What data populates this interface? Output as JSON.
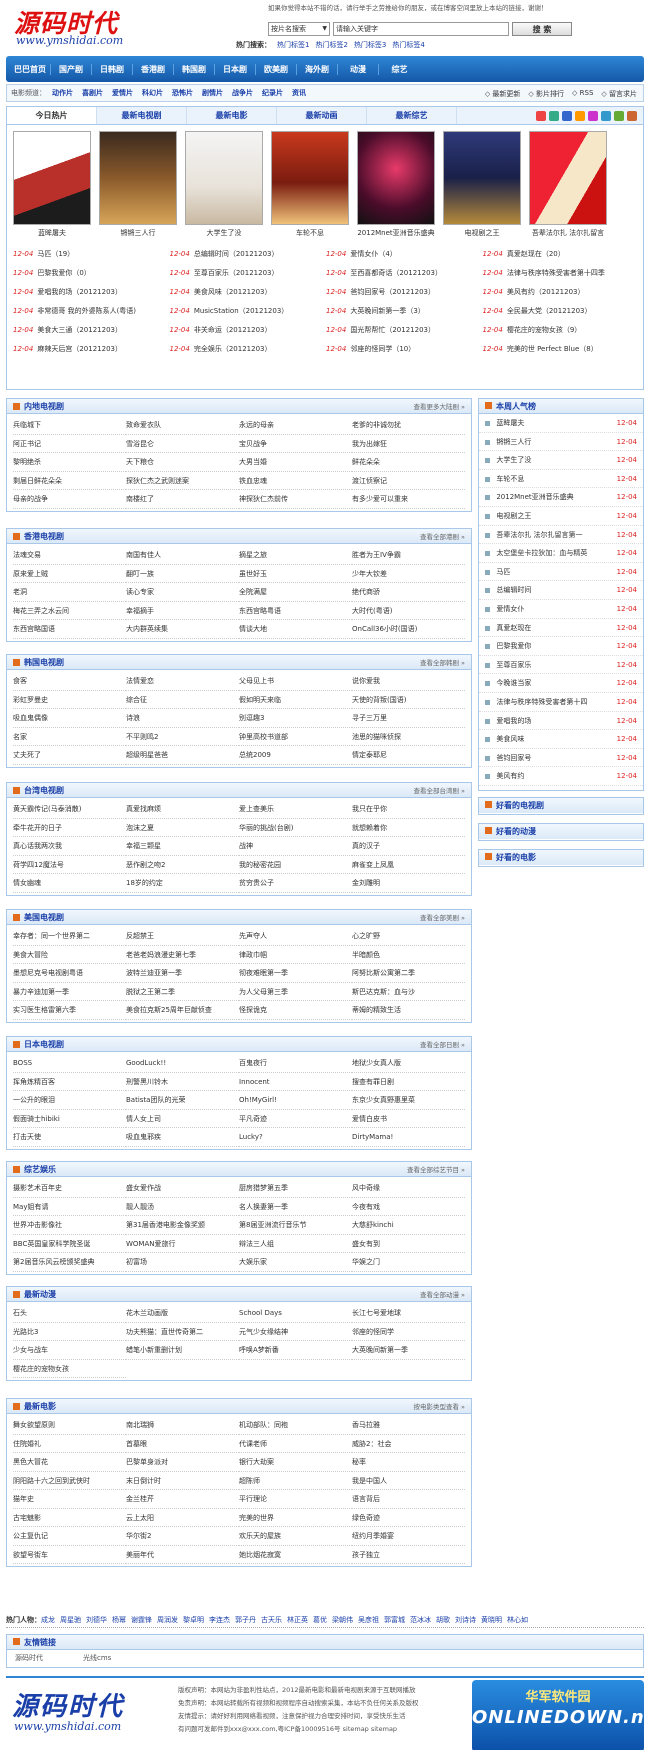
{
  "header": {
    "logo_cn": "源码时代",
    "logo_url": "www.ymshidai.com",
    "notice": "如果你觉得本站不错的话，请行举手之劳推给你的朋友，或在博客空间里放上本站的链接，谢谢！",
    "search_select": "按片名搜索",
    "search_value": "请输入关键字",
    "search_button": "搜 索",
    "hot_label": "热门搜索：",
    "hot_words": [
      "热门标签1",
      "热门标签2",
      "热门标签3",
      "热门标签4"
    ]
  },
  "nav": [
    "巴巴首页",
    "国产剧",
    "日韩剧",
    "香港剧",
    "韩国剧",
    "日本剧",
    "欧美剧",
    "海外剧",
    "动漫",
    "综艺"
  ],
  "subnav": {
    "label": "电影频道：",
    "items": [
      "动作片",
      "喜剧片",
      "爱情片",
      "科幻片",
      "恐怖片",
      "剧情片",
      "战争片",
      "纪录片",
      "资讯"
    ],
    "right": [
      "◇ 最新更新",
      "◇ 影片排行",
      "◇ RSS",
      "◇ 留言求片"
    ]
  },
  "featured": {
    "tabs": [
      "今日热片",
      "最新电视剧",
      "最新电影",
      "最新动画",
      "最新综艺"
    ],
    "posters": [
      "蓝眸屠夫",
      "锵锵三人行",
      "大学生了没",
      "车轮不息",
      "2012Mnet亚洲音乐盛典",
      "电视剧之王",
      "吾辈法尔扎 法尔扎留言"
    ],
    "newlist": [
      {
        "d": "12-04",
        "t": "马匹（19）"
      },
      {
        "d": "12-04",
        "t": "总编辑时间（20121203）"
      },
      {
        "d": "12-04",
        "t": "爱情女仆（4）"
      },
      {
        "d": "12-04",
        "t": "真爱赵现在（20）"
      },
      {
        "d": "12-04",
        "t": "巴黎我爱你（0）"
      },
      {
        "d": "12-04",
        "t": "至尊百家乐（20121203）"
      },
      {
        "d": "12-04",
        "t": "至西喜都奇话（20121203）"
      },
      {
        "d": "12-04",
        "t": "法律与秩序特殊受害者第十四季"
      },
      {
        "d": "12-04",
        "t": "爱唱我的场（20121203）"
      },
      {
        "d": "12-04",
        "t": "美食风味（20121203）"
      },
      {
        "d": "12-04",
        "t": "爸钧回家号（20121203）"
      },
      {
        "d": "12-04",
        "t": "美风有约（20121203）"
      },
      {
        "d": "12-04",
        "t": "非常德哥 我的外婆陈系人(粤语)"
      },
      {
        "d": "12-04",
        "t": "MusicStation（20121203）"
      },
      {
        "d": "12-04",
        "t": "大英晚间新第一季（3）"
      },
      {
        "d": "12-04",
        "t": "全民最大党（20121203）"
      },
      {
        "d": "12-04",
        "t": "美食大三通（20121203）"
      },
      {
        "d": "12-04",
        "t": "非关命运（20121203）"
      },
      {
        "d": "12-04",
        "t": "国光帮帮忙（20121203）"
      },
      {
        "d": "12-04",
        "t": "樱花庄的宠物女孩（9）"
      },
      {
        "d": "12-04",
        "t": "麻辣天后宫（20121203）"
      },
      {
        "d": "12-04",
        "t": "完全娱乐（20121203）"
      },
      {
        "d": "12-04",
        "t": "邻座的怪同学（10）"
      },
      {
        "d": "12-04",
        "t": "完美的世 Perfect Blue（8）"
      }
    ]
  },
  "sections": [
    {
      "title": "内地电视剧",
      "more": "查看更多大陆剧 »",
      "items": [
        "兵临城下",
        "致命爱衣队",
        "永远的母亲",
        "老爹的非诚勿扰",
        "阿正书记",
        "雪浴昆仑",
        "宝贝战争",
        "我为出嫁狂",
        "黎明绝杀",
        "天下粮仓",
        "大男当婚",
        "鲜花朵朵",
        "剩届日鲜花朵朵",
        "探狄仁杰之武则迷案",
        "铁血忠魂",
        "渡江侦察记",
        "母亲的战争",
        "南楼红了",
        "神探狄仁杰前传",
        "有多少爱可以重来"
      ]
    },
    {
      "title": "香港电视剧",
      "more": "查看全部港剧 »",
      "items": [
        "法魂交易",
        "南国有佳人",
        "摘星之旅",
        "胜者为王IV争霸",
        "原来爱上贼",
        "翻叮一族",
        "虽世好玉",
        "少年大钦差",
        "老洞",
        "读心专家",
        "全院满屋",
        "绝代商骄",
        "梅花三弄之水云间",
        "幸福摘手",
        "东西宫略粤语",
        "大时代(粤语)",
        "东西宫略国语",
        "大内群英续集",
        "情谈大地",
        "OnCall36小时(国语)"
      ]
    },
    {
      "title": "韩国电视剧",
      "more": "查看全部韩剧 »",
      "items": [
        "食客",
        "法情爱恋",
        "父母见上书",
        "说你爱我",
        "彩虹罗曼史",
        "综合征",
        "假如明天来临",
        "天使的背叛(国语)",
        "吸血鬼偶像",
        "诗浪",
        "别逗趣3",
        "寻子三万里",
        "名家",
        "不平则鸣2",
        "钟里高校书道部",
        "池思的猫咪侦探",
        "丈夫死了",
        "超级明星爸爸",
        "总统2009",
        "情定泰耶尼"
      ]
    },
    {
      "title": "台湾电视剧",
      "more": "查看全部台湾剧 »",
      "items": [
        "黄天霸传记(马泰消散)",
        "真爱找麻烦",
        "爱上查美乐",
        "我只在乎你",
        "牵牛花开的日子",
        "泡沫之夏",
        "华丽的挑战(台剧)",
        "就想赖着你",
        "真心话我两次我",
        "幸福三颗星",
        "战神",
        "真的汉子",
        "荷学四12魔法号",
        "恶作剧之吻2",
        "我的秘密花园",
        "麻雀变上凤凰",
        "情女幽魂",
        "18岁的约定",
        "贫穷贵公子",
        "金刘雕明"
      ]
    },
    {
      "title": "美国电视剧",
      "more": "查看全部美剧 »",
      "items": [
        "幸存者：同一个世界第二",
        "反超禁王",
        "先声夺人",
        "心之旷野",
        "美食大冒险",
        "老爸老妈浪漫史第七季",
        "律政巾帼",
        "半暗颜色",
        "墨想尼克号电视剧粤语",
        "波特兰迪亚第一季",
        "彻夜难眠第一季",
        "阿努比斯公寓第二季",
        "暴力辛迪加第一季",
        "脱狱之王第二季",
        "为人父母第三季",
        "斯巴达克斯：血与沙",
        "实习医生格雷第六季",
        "美食拉克斯25周年巨献侦查",
        "怪探诡克",
        "蒂姆的精致生活"
      ]
    },
    {
      "title": "日本电视剧",
      "more": "查看全部日剧 »",
      "items": [
        "BOSS",
        "GoodLuck!!",
        "百鬼夜行",
        "地狱少女真人版",
        "挥角炼精百客",
        "刑警黑川铃木",
        "Innocent",
        "搜查有罪日剧",
        "一公升的眼泪",
        "Batista团队的光荣",
        "Oh!MyGirl!",
        "东京少女真野惠里菜",
        "假面骑士hibiki",
        "情人女上司",
        "平凡奇迹",
        "爱情白皮书",
        "打击天使",
        "吸血鬼邪疾",
        "Lucky?",
        "DirtyMama!"
      ]
    },
    {
      "title": "综艺娱乐",
      "more": "查看全部综艺节目 »",
      "items": [
        "摄影艺术百年史",
        "盛女爱作战",
        "厨房猎梦第五季",
        "风中奇缘",
        "May姐有请",
        "靓人靓汤",
        "名人换妻第一季",
        "今夜有戏",
        "世界冲击影像社",
        "第31届香港电影金像奖颁",
        "第8届亚洲流行音乐节",
        "大慈舒kinchi",
        "BBC英国皇家科学院圣诞",
        "WOMAN爱旅行",
        "辩法三人组",
        "盛女有到",
        "第2届音乐风云榜颁奖盛典",
        "初富场",
        "大娱乐家",
        "华娱之门"
      ]
    },
    {
      "title": "最新动漫",
      "more": "查看全部动漫 »",
      "items": [
        "石头",
        "花木兰动画版",
        "School Days",
        "长江七号爱地球",
        "光路比3",
        "功夫熊猫：直世传奇第二",
        "元气少女缘结神",
        "邻座的怪同学",
        "少女与战车",
        "蜡笔小新重删计划",
        "呼唤A梦新番",
        "大英晚间新第一季",
        "樱花庄的宠物女孩"
      ]
    },
    {
      "title": "最新电影",
      "more": "按电影类型查看 »",
      "items": [
        "舞女欲望原则",
        "南北瑞狮",
        "机动部队：同袍",
        "香马拉雅",
        "住院婚礼",
        "首墓眼",
        "代课老师",
        "威胁2：社会",
        "黑色大冒花",
        "巴黎单身派对",
        "银行大劫案",
        "秘率",
        "阴阳路十六之回到武侠时",
        "末日倒计时",
        "超陈师",
        "我是中国人",
        "猫年史",
        "金兰桂芹",
        "平行理论",
        "语言背后",
        "古宅魅影",
        "云上太阳",
        "完美的世界",
        "绿色奇迹",
        "公主复仇记",
        "华尔街2",
        "欢乐天的屋族",
        "纽约月季婚宴",
        "欲望号街车",
        "美丽年代",
        "她比烟花寂寞",
        "孩子独立"
      ]
    }
  ],
  "side_rank": {
    "title": "本周人气榜",
    "items": [
      {
        "t": "蓝眸屠夫",
        "d": "12-04"
      },
      {
        "t": "锵锵三人行",
        "d": "12-04"
      },
      {
        "t": "大学生了没",
        "d": "12-04"
      },
      {
        "t": "车轮不息",
        "d": "12-04"
      },
      {
        "t": "2012Mnet亚洲音乐盛典",
        "d": "12-04"
      },
      {
        "t": "电视剧之王",
        "d": "12-04"
      },
      {
        "t": "吾辈法尔扎 法尔扎留言第一",
        "d": "12-04"
      },
      {
        "t": "太空堡垒卡拉狄加：血与精英",
        "d": "12-04"
      },
      {
        "t": "马匹",
        "d": "12-04"
      },
      {
        "t": "总编辑时间",
        "d": "12-04"
      },
      {
        "t": "爱情女仆",
        "d": "12-04"
      },
      {
        "t": "真爱赵现在",
        "d": "12-04"
      },
      {
        "t": "巴黎我爱你",
        "d": "12-04"
      },
      {
        "t": "至尊百家乐",
        "d": "12-04"
      },
      {
        "t": "今晚谁当家",
        "d": "12-04"
      },
      {
        "t": "法律与秩序特殊受害者第十四",
        "d": "12-04"
      },
      {
        "t": "爱唱我的场",
        "d": "12-04"
      },
      {
        "t": "美食风味",
        "d": "12-04"
      },
      {
        "t": "爸钧回家号",
        "d": "12-04"
      },
      {
        "t": "美风有约",
        "d": "12-04"
      }
    ]
  },
  "side_boxes": [
    "好看的电视剧",
    "好看的动漫",
    "好看的电影"
  ],
  "hotsearch": {
    "label": "热门人物：",
    "names": [
      "成龙",
      "周星驰",
      "刘德华",
      "杨幂",
      "谢霆锋",
      "周润发",
      "黎卓明",
      "李连杰",
      "郭子丹",
      "古天乐",
      "林正英",
      "葛优",
      "梁朝伟",
      "吴彦祖",
      "郭富城",
      "范冰冰",
      "胡歌",
      "刘诗诗",
      "黄晓明",
      "林心如"
    ]
  },
  "friendlinks": {
    "title": "友情链接",
    "items": [
      "源码时代",
      "光线cms"
    ]
  },
  "footer": {
    "logo_cn": "源码时代",
    "logo_url": "www.ymshidai.com",
    "lines": [
      "版权声明：本网站为非盈利性站点，2012最新电影和最新电视剧来源于互联网播放",
      "免责声明：本网站转载所有视频和视频程序自动搜索采集，本站不负任何关系及版权",
      "友情提示：请好好利用网络看视频，注意保护视力合理安排时间，享受快乐生活",
      "有问题可发邮件到xxx@xxx.com,粤ICP备10009516号   sitemap sitemap"
    ],
    "badge_cn": "华军软件园",
    "badge_en": "ONLINEDOWN.net"
  }
}
